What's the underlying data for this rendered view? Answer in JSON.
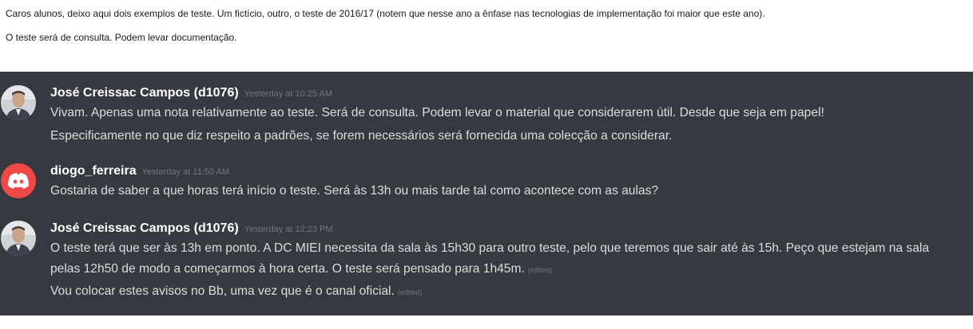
{
  "intro": {
    "line1": "Caros alunos, deixo aqui dois exemplos de teste. Um fictício, outro, o teste de 2016/17 (notem que nesse ano a ênfase nas tecnologias de implementação foi maior que este ano).",
    "line2": "O teste será de consulta. Podem levar documentação."
  },
  "messages": [
    {
      "author": "José Creissac Campos (d1076)",
      "timestamp": "Yesterday at 10:25 AM",
      "avatar": "person-photo",
      "lines": [
        "Vivam. Apenas uma nota relativamente ao teste. Será de consulta. Podem levar o material que considerarem útil. Desde que seja em papel!",
        "Especificamente no que diz respeito a padrões, se forem necessários será fornecida uma colecção a considerar."
      ]
    },
    {
      "author": "diogo_ferreira",
      "timestamp": "Yesterday at 11:50 AM",
      "avatar": "discord-logo",
      "avatar_color": "#f04747",
      "lines": [
        "Gostaria de saber a que horas terá início o teste. Será às 13h ou mais tarde tal como acontece com as aulas?"
      ]
    },
    {
      "author": "José Creissac Campos (d1076)",
      "timestamp": "Yesterday at 12:23 PM",
      "avatar": "person-photo",
      "lines": [
        "O teste terá que ser às 13h em ponto. A DC MIEI necessita da sala às 15h30 para outro teste, pelo que teremos que sair até às 15h. Peço que estejam na sala",
        "pelas 12h50 de modo a começarmos à hora certa. O teste será pensado para 1h45m.",
        "Vou colocar estes avisos no Bb, uma vez que é o canal oficial."
      ],
      "edited_label": "(edited)"
    }
  ],
  "colors": {
    "chat_background": "#36393f",
    "author": "#ffffff",
    "message_text": "#dcddde",
    "timestamp": "#72767d"
  }
}
